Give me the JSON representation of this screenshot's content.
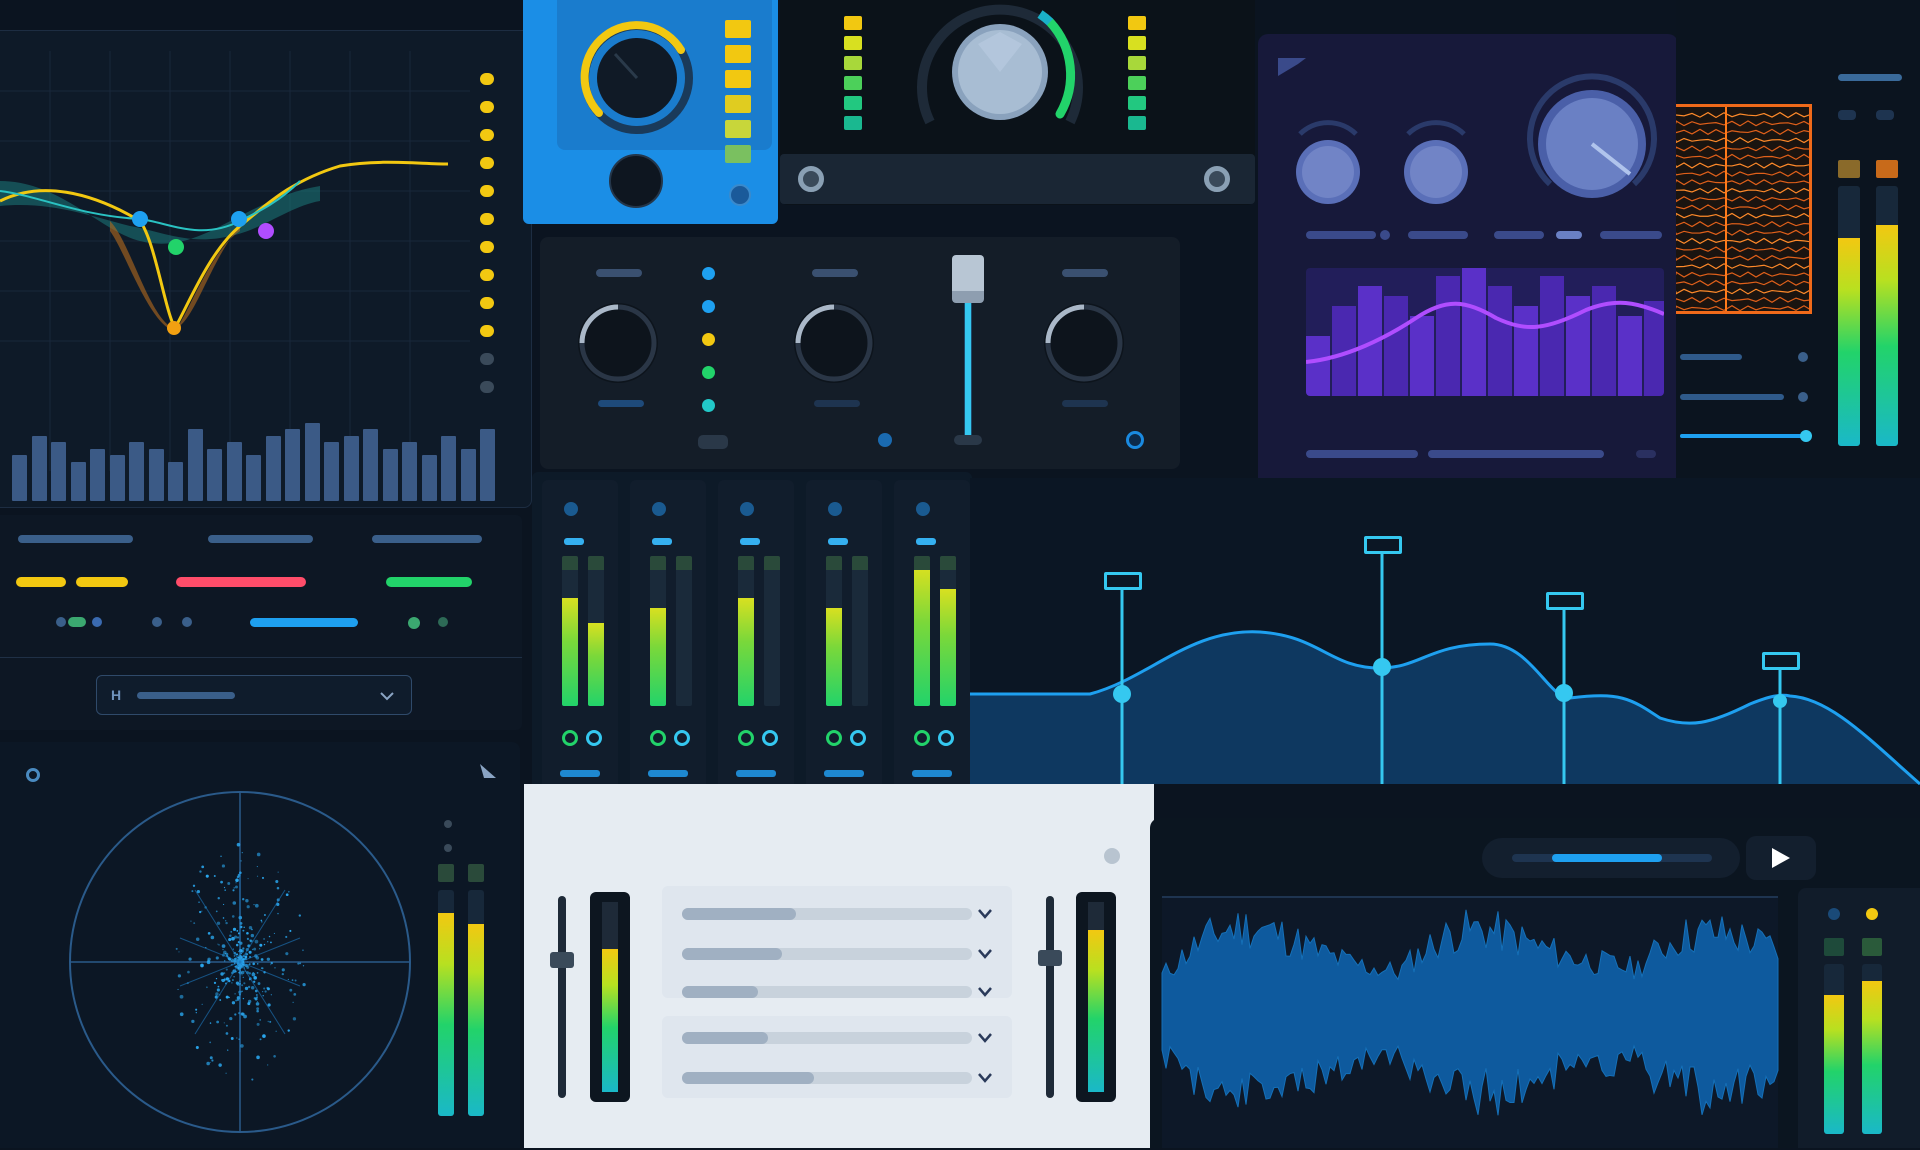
{
  "colors": {
    "background": "#0b1420",
    "panel_dark": "#111b29",
    "accent_blue": "#1ea0f0",
    "accent_cyan": "#35c8f0",
    "accent_yellow": "#f2c811",
    "accent_green": "#22d36a",
    "accent_red": "#ff4d6a",
    "accent_purple": "#9d4df2",
    "accent_orange": "#ff7a1a",
    "light_panel": "#e6ecf2"
  },
  "icons": {
    "play": "play-icon",
    "chevron": "chevron-down-icon",
    "knob": "knob-icon",
    "fader": "fader-handle-icon",
    "screw": "screw-icon"
  },
  "meters": {
    "eq_spectrum": [
      0.35,
      0.5,
      0.45,
      0.3,
      0.4,
      0.35,
      0.45,
      0.4,
      0.3,
      0.55,
      0.4,
      0.45,
      0.35,
      0.5,
      0.55,
      0.6,
      0.45,
      0.5,
      0.55,
      0.4,
      0.45,
      0.35,
      0.5,
      0.4,
      0.55
    ],
    "right_stereo": [
      0.8,
      0.85
    ],
    "scope_stereo": [
      0.9,
      0.85
    ],
    "mixer_channels": [
      [
        0.72,
        0.55
      ],
      [
        0.65,
        0.0
      ],
      [
        0.72,
        0.0
      ],
      [
        0.65,
        0.0
      ],
      [
        0.92,
        0.78
      ]
    ],
    "small_fader_left": 0.75,
    "small_fader_right": 0.85,
    "bottom_right_stereo": [
      0.82,
      0.9
    ]
  },
  "playback": {
    "progress": 0.55
  }
}
